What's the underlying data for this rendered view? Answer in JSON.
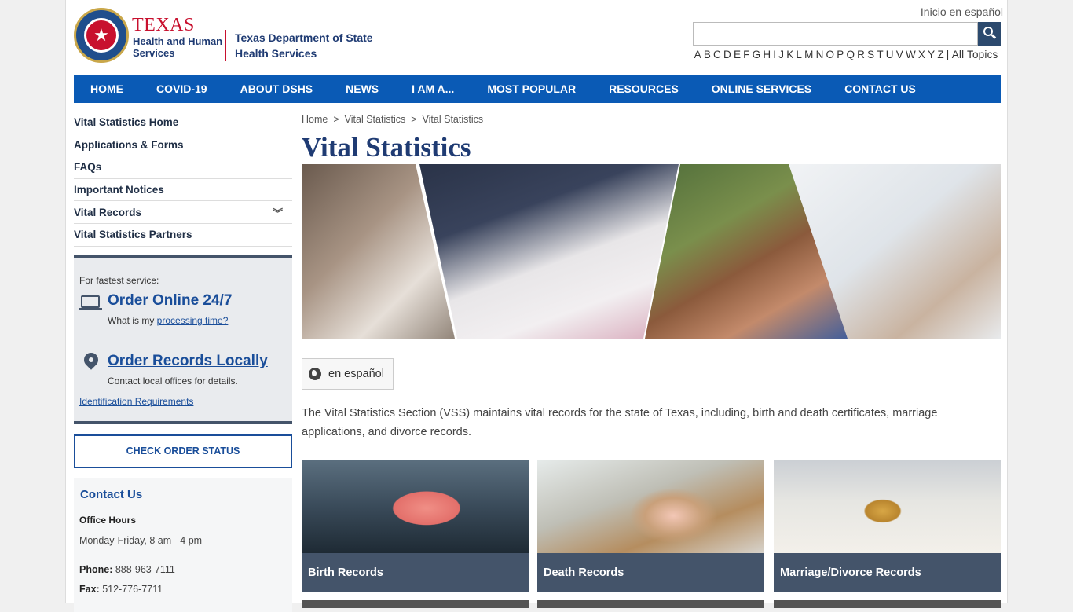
{
  "header": {
    "hhs_line1": "TEXAS",
    "hhs_line2": "Health and Human Services",
    "dshs_name": "Texas Department of State Health Services",
    "spanish_link": "Inicio en español",
    "search_placeholder": "",
    "az_letters": [
      "A",
      "B",
      "C",
      "D",
      "E",
      "F",
      "G",
      "H",
      "I",
      "J",
      "K",
      "L",
      "M",
      "N",
      "O",
      "P",
      "Q",
      "R",
      "S",
      "T",
      "U",
      "V",
      "W",
      "X",
      "Y",
      "Z"
    ],
    "all_topics": "| All Topics"
  },
  "nav": [
    "HOME",
    "COVID-19",
    "ABOUT DSHS",
    "NEWS",
    "I AM A...",
    "MOST POPULAR",
    "RESOURCES",
    "ONLINE SERVICES",
    "CONTACT US"
  ],
  "sidebar": {
    "items": [
      "Vital Statistics Home",
      "Applications & Forms",
      "FAQs",
      "Important Notices",
      "Vital Records",
      "Vital Statistics Partners"
    ],
    "service": {
      "fastest": "For fastest service:",
      "order_online": "Order Online 24/7",
      "processing_prefix": "What is my ",
      "processing_link": "processing time?",
      "order_local": "Order Records Locally",
      "contact_local": "Contact local offices for details.",
      "id_req": "Identification Requirements"
    },
    "check_status": "CHECK ORDER STATUS",
    "contact": {
      "title": "Contact Us",
      "hours_label": "Office Hours",
      "hours_value": "Monday-Friday, 8 am - 4 pm",
      "phone_label": "Phone:",
      "phone_value": "888-963-7111",
      "fax_label": "Fax:",
      "fax_value": "512-776-7711"
    }
  },
  "main": {
    "breadcrumb": [
      "Home",
      "Vital Statistics",
      "Vital Statistics"
    ],
    "breadcrumb_sep": ">",
    "title": "Vital Statistics",
    "lang_button": "en español",
    "intro": "The Vital Statistics Section (VSS) maintains vital records for the state of Texas, including, birth and death certificates, marriage applications, and divorce records.",
    "cards": [
      "Birth Records",
      "Death Records",
      "Marriage/Divorce Records"
    ]
  },
  "colors": {
    "nav_blue": "#0a5ab5",
    "navy": "#1f3b73",
    "slate": "#44546a",
    "red": "#c8102e"
  }
}
